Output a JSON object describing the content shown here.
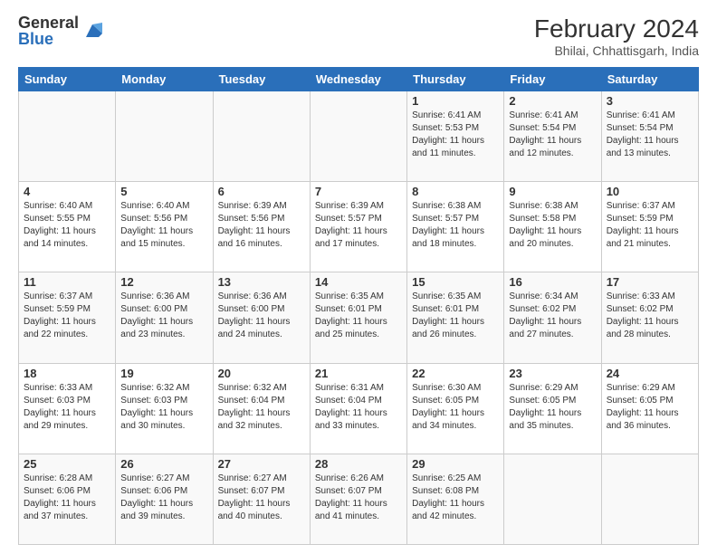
{
  "header": {
    "logo_general": "General",
    "logo_blue": "Blue",
    "title": "February 2024",
    "subtitle": "Bhilai, Chhattisgarh, India"
  },
  "days_of_week": [
    "Sunday",
    "Monday",
    "Tuesday",
    "Wednesday",
    "Thursday",
    "Friday",
    "Saturday"
  ],
  "weeks": [
    [
      {
        "day": "",
        "info": ""
      },
      {
        "day": "",
        "info": ""
      },
      {
        "day": "",
        "info": ""
      },
      {
        "day": "",
        "info": ""
      },
      {
        "day": "1",
        "info": "Sunrise: 6:41 AM\nSunset: 5:53 PM\nDaylight: 11 hours and 11 minutes."
      },
      {
        "day": "2",
        "info": "Sunrise: 6:41 AM\nSunset: 5:54 PM\nDaylight: 11 hours and 12 minutes."
      },
      {
        "day": "3",
        "info": "Sunrise: 6:41 AM\nSunset: 5:54 PM\nDaylight: 11 hours and 13 minutes."
      }
    ],
    [
      {
        "day": "4",
        "info": "Sunrise: 6:40 AM\nSunset: 5:55 PM\nDaylight: 11 hours and 14 minutes."
      },
      {
        "day": "5",
        "info": "Sunrise: 6:40 AM\nSunset: 5:56 PM\nDaylight: 11 hours and 15 minutes."
      },
      {
        "day": "6",
        "info": "Sunrise: 6:39 AM\nSunset: 5:56 PM\nDaylight: 11 hours and 16 minutes."
      },
      {
        "day": "7",
        "info": "Sunrise: 6:39 AM\nSunset: 5:57 PM\nDaylight: 11 hours and 17 minutes."
      },
      {
        "day": "8",
        "info": "Sunrise: 6:38 AM\nSunset: 5:57 PM\nDaylight: 11 hours and 18 minutes."
      },
      {
        "day": "9",
        "info": "Sunrise: 6:38 AM\nSunset: 5:58 PM\nDaylight: 11 hours and 20 minutes."
      },
      {
        "day": "10",
        "info": "Sunrise: 6:37 AM\nSunset: 5:59 PM\nDaylight: 11 hours and 21 minutes."
      }
    ],
    [
      {
        "day": "11",
        "info": "Sunrise: 6:37 AM\nSunset: 5:59 PM\nDaylight: 11 hours and 22 minutes."
      },
      {
        "day": "12",
        "info": "Sunrise: 6:36 AM\nSunset: 6:00 PM\nDaylight: 11 hours and 23 minutes."
      },
      {
        "day": "13",
        "info": "Sunrise: 6:36 AM\nSunset: 6:00 PM\nDaylight: 11 hours and 24 minutes."
      },
      {
        "day": "14",
        "info": "Sunrise: 6:35 AM\nSunset: 6:01 PM\nDaylight: 11 hours and 25 minutes."
      },
      {
        "day": "15",
        "info": "Sunrise: 6:35 AM\nSunset: 6:01 PM\nDaylight: 11 hours and 26 minutes."
      },
      {
        "day": "16",
        "info": "Sunrise: 6:34 AM\nSunset: 6:02 PM\nDaylight: 11 hours and 27 minutes."
      },
      {
        "day": "17",
        "info": "Sunrise: 6:33 AM\nSunset: 6:02 PM\nDaylight: 11 hours and 28 minutes."
      }
    ],
    [
      {
        "day": "18",
        "info": "Sunrise: 6:33 AM\nSunset: 6:03 PM\nDaylight: 11 hours and 29 minutes."
      },
      {
        "day": "19",
        "info": "Sunrise: 6:32 AM\nSunset: 6:03 PM\nDaylight: 11 hours and 30 minutes."
      },
      {
        "day": "20",
        "info": "Sunrise: 6:32 AM\nSunset: 6:04 PM\nDaylight: 11 hours and 32 minutes."
      },
      {
        "day": "21",
        "info": "Sunrise: 6:31 AM\nSunset: 6:04 PM\nDaylight: 11 hours and 33 minutes."
      },
      {
        "day": "22",
        "info": "Sunrise: 6:30 AM\nSunset: 6:05 PM\nDaylight: 11 hours and 34 minutes."
      },
      {
        "day": "23",
        "info": "Sunrise: 6:29 AM\nSunset: 6:05 PM\nDaylight: 11 hours and 35 minutes."
      },
      {
        "day": "24",
        "info": "Sunrise: 6:29 AM\nSunset: 6:05 PM\nDaylight: 11 hours and 36 minutes."
      }
    ],
    [
      {
        "day": "25",
        "info": "Sunrise: 6:28 AM\nSunset: 6:06 PM\nDaylight: 11 hours and 37 minutes."
      },
      {
        "day": "26",
        "info": "Sunrise: 6:27 AM\nSunset: 6:06 PM\nDaylight: 11 hours and 39 minutes."
      },
      {
        "day": "27",
        "info": "Sunrise: 6:27 AM\nSunset: 6:07 PM\nDaylight: 11 hours and 40 minutes."
      },
      {
        "day": "28",
        "info": "Sunrise: 6:26 AM\nSunset: 6:07 PM\nDaylight: 11 hours and 41 minutes."
      },
      {
        "day": "29",
        "info": "Sunrise: 6:25 AM\nSunset: 6:08 PM\nDaylight: 11 hours and 42 minutes."
      },
      {
        "day": "",
        "info": ""
      },
      {
        "day": "",
        "info": ""
      }
    ]
  ]
}
